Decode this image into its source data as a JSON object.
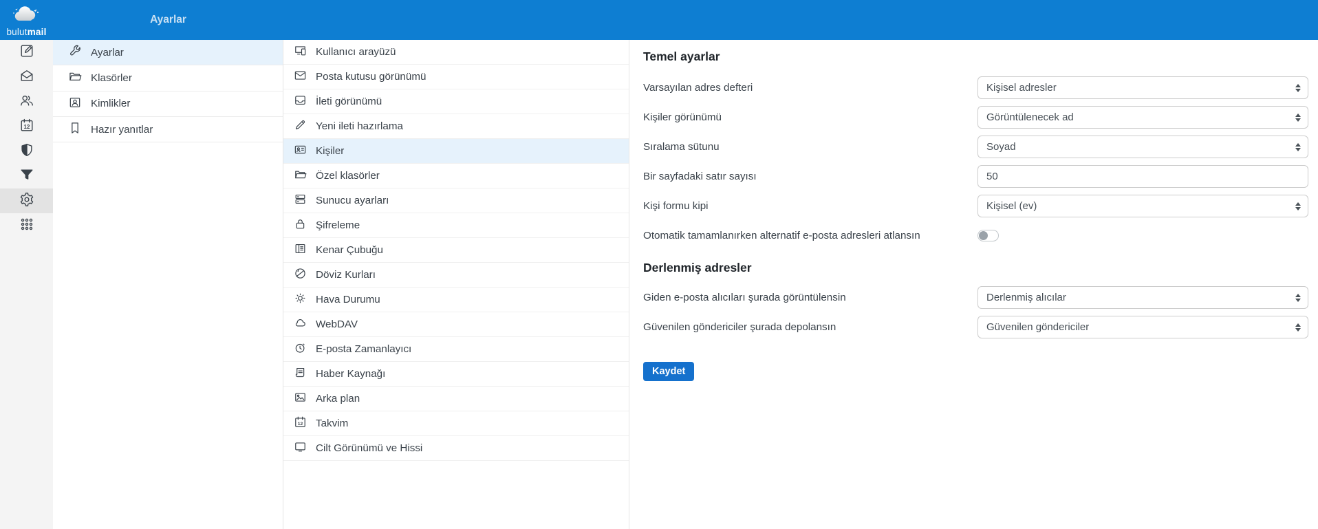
{
  "topbar": {
    "brand_light": "bulut",
    "brand_bold": "mail",
    "title": "Ayarlar"
  },
  "rail": {
    "items": [
      {
        "icon": "compose-icon"
      },
      {
        "icon": "mail-icon"
      },
      {
        "icon": "contacts-icon"
      },
      {
        "icon": "calendar-icon"
      },
      {
        "icon": "security-icon"
      },
      {
        "icon": "filter-icon"
      },
      {
        "icon": "settings-icon",
        "selected": true
      },
      {
        "icon": "apps-icon"
      }
    ]
  },
  "settings_nav": {
    "items": [
      {
        "label": "Ayarlar",
        "selected": true
      },
      {
        "label": "Klasörler"
      },
      {
        "label": "Kimlikler"
      },
      {
        "label": "Hazır yanıtlar"
      }
    ]
  },
  "settings_sections": {
    "items": [
      {
        "label": "Kullanıcı arayüzü"
      },
      {
        "label": "Posta kutusu görünümü"
      },
      {
        "label": "İleti görünümü"
      },
      {
        "label": "Yeni ileti hazırlama"
      },
      {
        "label": "Kişiler",
        "selected": true
      },
      {
        "label": "Özel klasörler"
      },
      {
        "label": "Sunucu ayarları"
      },
      {
        "label": "Şifreleme"
      },
      {
        "label": "Kenar Çubuğu"
      },
      {
        "label": "Döviz Kurları"
      },
      {
        "label": "Hava Durumu"
      },
      {
        "label": "WebDAV"
      },
      {
        "label": "E-posta Zamanlayıcı"
      },
      {
        "label": "Haber Kaynağı"
      },
      {
        "label": "Arka plan"
      },
      {
        "label": "Takvim"
      },
      {
        "label": "Cilt Görünümü ve Hissi"
      }
    ]
  },
  "form": {
    "section1_title": "Temel ayarlar",
    "fields": {
      "default_addressbook": {
        "label": "Varsayılan adres defteri",
        "value": "Kişisel adresler"
      },
      "contacts_view": {
        "label": "Kişiler görünümü",
        "value": "Görüntülenecek ad"
      },
      "sort_column": {
        "label": "Sıralama sütunu",
        "value": "Soyad"
      },
      "rows_per_page": {
        "label": "Bir sayfadaki satır sayısı",
        "value": "50"
      },
      "contact_form_mode": {
        "label": "Kişi formu kipi",
        "value": "Kişisel (ev)"
      },
      "skip_alternative_emails": {
        "label": "Otomatik tamamlanırken alternatif e-posta adresleri atlansın",
        "value": "off"
      }
    },
    "section2_title": "Derlenmiş adresler",
    "fields2": {
      "collected_recipients": {
        "label": "Giden e-posta alıcıları şurada görüntülensin",
        "value": "Derlenmiş alıcılar"
      },
      "trusted_senders": {
        "label": "Güvenilen göndericiler şurada depolansın",
        "value": "Güvenilen göndericiler"
      }
    },
    "save_label": "Kaydet"
  },
  "colors": {
    "topbar_blue": "#0e7ed2",
    "accent_blue": "#1571cd",
    "selected_row_blue": "#e6f2fc",
    "rail_bg": "#f4f4f4",
    "rail_selected": "#e3e3e3"
  }
}
